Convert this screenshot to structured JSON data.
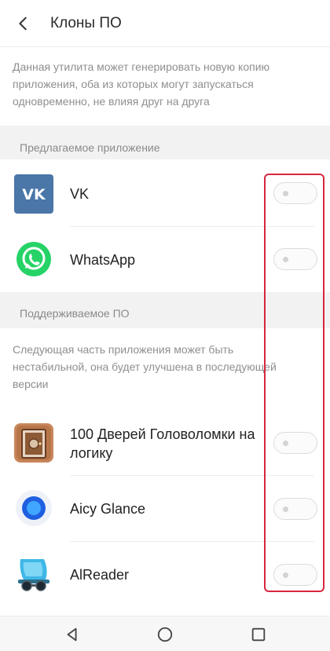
{
  "header": {
    "title": "Клоны ПО"
  },
  "intro": "Данная утилита может генерировать новую копию приложения, оба из которых могут запускаться одновременно, не влияя друг на друга",
  "suggested": {
    "label": "Предлагаемое приложение",
    "apps": [
      {
        "name": "VK",
        "enabled": false,
        "icon": "vk-logo"
      },
      {
        "name": "WhatsApp",
        "enabled": false,
        "icon": "whatsapp-logo"
      }
    ]
  },
  "supported": {
    "label": "Поддерживаемое ПО",
    "note": "Следующая часть приложения может быть нестабильной, она будет улучшена в последующей версии",
    "apps": [
      {
        "name": "100 Дверей Головоломки на логику",
        "enabled": false,
        "icon": "doors-game-icon"
      },
      {
        "name": "Aicy Glance",
        "enabled": false,
        "icon": "aicy-glance-icon"
      },
      {
        "name": "AlReader",
        "enabled": false,
        "icon": "alreader-icon"
      }
    ]
  },
  "colors": {
    "highlight": "#d7263d",
    "vk": "#4a76a8",
    "whatsapp": "#25d366",
    "aicy": "#2f7bf6"
  }
}
